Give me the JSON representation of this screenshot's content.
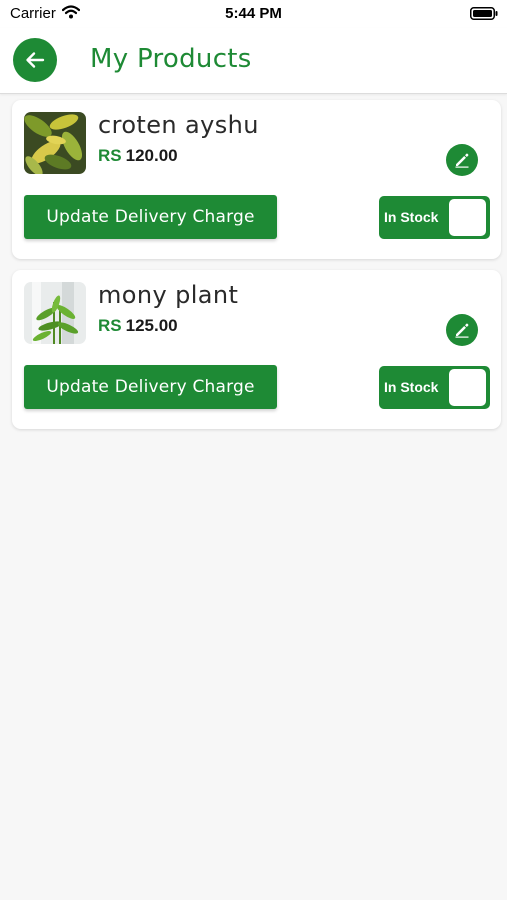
{
  "status_bar": {
    "carrier": "Carrier",
    "time": "5:44 PM"
  },
  "header": {
    "title": "My Products",
    "back_icon": "arrow-left-icon"
  },
  "colors": {
    "brand_green": "#1e8a35",
    "background": "#f7f7f7"
  },
  "products": [
    {
      "name": "croten ayshu",
      "currency": "RS",
      "price": "120.00",
      "delivery_button": "Update Delivery Charge",
      "stock_label": "In Stock"
    },
    {
      "name": "mony plant",
      "currency": "RS",
      "price": "125.00",
      "delivery_button": "Update Delivery Charge",
      "stock_label": "In Stock"
    }
  ]
}
